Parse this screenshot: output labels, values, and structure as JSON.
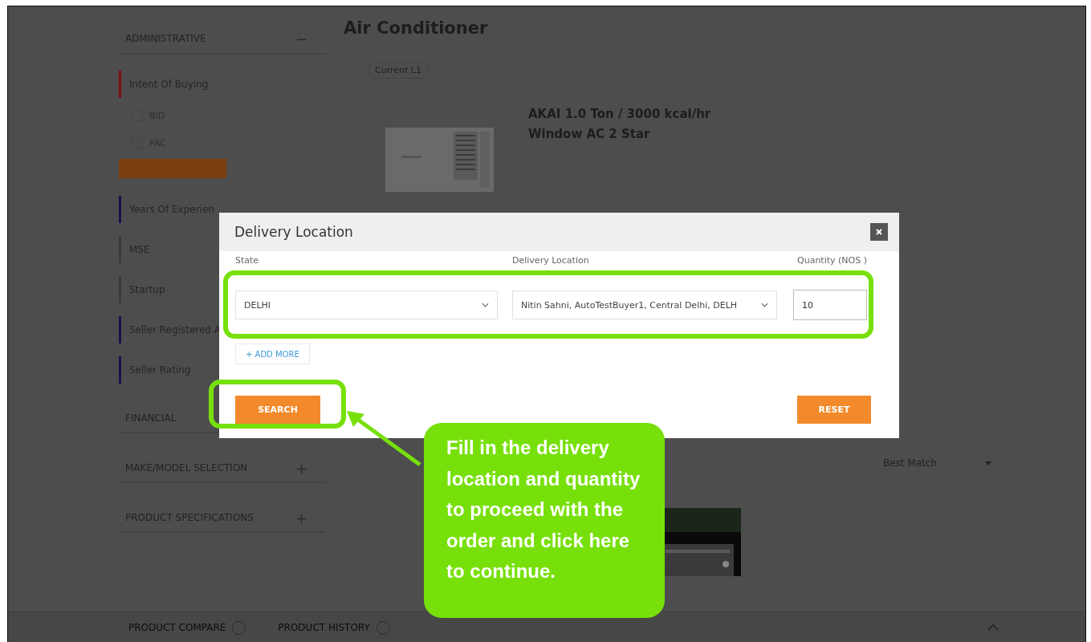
{
  "sidebar": {
    "header": {
      "title": "ADMINISTRATIVE",
      "toggle": "−"
    },
    "filters": [
      {
        "label": "Intent Of Buying",
        "color": "#7a1010",
        "options": [
          {
            "label": "BID",
            "checked": false
          },
          {
            "label": "PAC",
            "checked": false
          }
        ],
        "action": true
      },
      {
        "label": "Years Of Experien",
        "color": "#14144a"
      },
      {
        "label": "MSE",
        "color": "#3a3a3a"
      },
      {
        "label": "Startup",
        "color": "#3a3a3a"
      },
      {
        "label": "Seller Registered A",
        "color": "#14144a"
      },
      {
        "label": "Seller Rating",
        "color": "#14144a"
      }
    ],
    "sections": [
      {
        "title": "FINANCIAL"
      },
      {
        "title": "MAKE/MODEL SELECTION",
        "toggle": "+"
      },
      {
        "title": "PRODUCT SPECIFICATIONS",
        "toggle": "+"
      }
    ]
  },
  "main": {
    "title": "Air Conditioner",
    "badge": "Current L1",
    "product": {
      "name": "AKAI 1.0 Ton / 3000 kcal/hr Window AC 2 Star"
    },
    "sort": {
      "value": "Best Match"
    }
  },
  "footer": {
    "links": [
      "PRODUCT COMPARE",
      "PRODUCT HISTORY"
    ]
  },
  "dialog": {
    "title": "Delivery Location",
    "fields": [
      {
        "label": "State",
        "kind": "select",
        "value": "DELHI"
      },
      {
        "label": "Delivery Location",
        "kind": "select",
        "value": "Nitin Sahni, AutoTestBuyer1, Central Delhi, DELH"
      },
      {
        "label": "Quantity (NOS )",
        "kind": "input",
        "value": "10"
      }
    ],
    "add_more": "+ ADD MORE",
    "buttons": [
      "SEARCH",
      "RESET"
    ]
  },
  "callout": {
    "text": "Fill in the delivery location and quantity to proceed with the order and click here to continue."
  }
}
